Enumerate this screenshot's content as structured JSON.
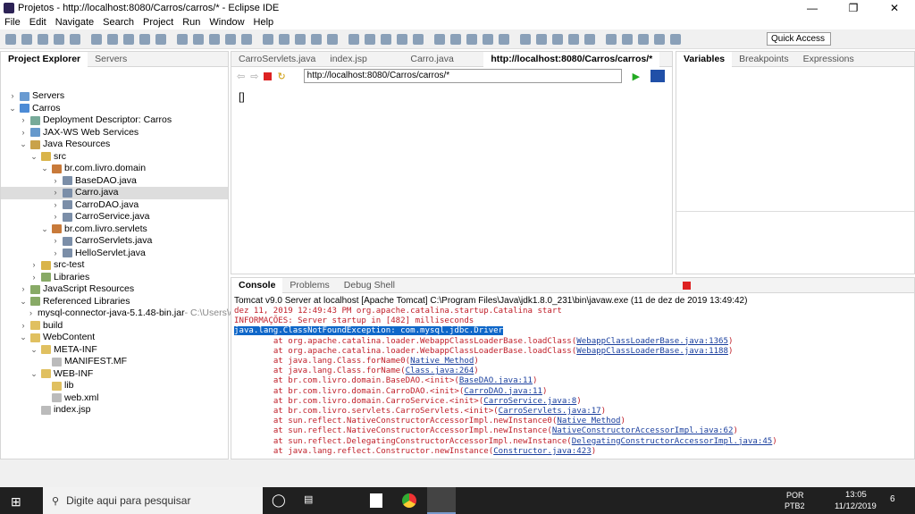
{
  "window": {
    "title": "Projetos - http://localhost:8080/Carros/carros/* - Eclipse IDE"
  },
  "menu": [
    "File",
    "Edit",
    "Navigate",
    "Search",
    "Project",
    "Run",
    "Window",
    "Help"
  ],
  "quick_access": "Quick Access",
  "left_tabs": [
    "Project Explorer",
    "Servers"
  ],
  "tree": [
    {
      "d": 0,
      "tw": ">",
      "label": "Servers",
      "c": "#6a9bd1"
    },
    {
      "d": 0,
      "tw": "v",
      "label": "Carros",
      "c": "#4c8bd6"
    },
    {
      "d": 1,
      "tw": ">",
      "label": "Deployment Descriptor: Carros",
      "c": "#7a9"
    },
    {
      "d": 1,
      "tw": ">",
      "label": "JAX-WS Web Services",
      "c": "#69c"
    },
    {
      "d": 1,
      "tw": "v",
      "label": "Java Resources",
      "c": "#c9a24a"
    },
    {
      "d": 2,
      "tw": "v",
      "label": "src",
      "c": "#d9b44a"
    },
    {
      "d": 3,
      "tw": "v",
      "label": "br.com.livro.domain",
      "c": "#c87a3a"
    },
    {
      "d": 4,
      "tw": ">",
      "label": "BaseDAO.java",
      "c": "#7b8ea8"
    },
    {
      "d": 4,
      "tw": ">",
      "label": "Carro.java",
      "c": "#7b8ea8",
      "sel": true
    },
    {
      "d": 4,
      "tw": ">",
      "label": "CarroDAO.java",
      "c": "#7b8ea8"
    },
    {
      "d": 4,
      "tw": ">",
      "label": "CarroService.java",
      "c": "#7b8ea8"
    },
    {
      "d": 3,
      "tw": "v",
      "label": "br.com.livro.servlets",
      "c": "#c87a3a"
    },
    {
      "d": 4,
      "tw": ">",
      "label": "CarroServlets.java",
      "c": "#7b8ea8"
    },
    {
      "d": 4,
      "tw": ">",
      "label": "HelloServlet.java",
      "c": "#7b8ea8"
    },
    {
      "d": 2,
      "tw": ">",
      "label": "src-test",
      "c": "#d9b44a"
    },
    {
      "d": 2,
      "tw": ">",
      "label": "Libraries",
      "c": "#8a6"
    },
    {
      "d": 1,
      "tw": ">",
      "label": "JavaScript Resources",
      "c": "#8a6"
    },
    {
      "d": 1,
      "tw": "v",
      "label": "Referenced Libraries",
      "c": "#8a6"
    },
    {
      "d": 2,
      "tw": ">",
      "label": "mysql-connector-java-5.1.48-bin.jar",
      "extra": " - C:\\Users\\da",
      "c": "#889"
    },
    {
      "d": 1,
      "tw": ">",
      "label": "build",
      "c": "#e0c060"
    },
    {
      "d": 1,
      "tw": "v",
      "label": "WebContent",
      "c": "#e0c060"
    },
    {
      "d": 2,
      "tw": "v",
      "label": "META-INF",
      "c": "#e0c060"
    },
    {
      "d": 3,
      "tw": "",
      "label": "MANIFEST.MF",
      "c": "#bbb"
    },
    {
      "d": 2,
      "tw": "v",
      "label": "WEB-INF",
      "c": "#e0c060"
    },
    {
      "d": 3,
      "tw": "",
      "label": "lib",
      "c": "#e0c060"
    },
    {
      "d": 3,
      "tw": "",
      "label": "web.xml",
      "c": "#bbb"
    },
    {
      "d": 2,
      "tw": "",
      "label": "index.jsp",
      "c": "#bbb"
    }
  ],
  "editor": {
    "tabs": [
      "CarroServlets.java",
      "index.jsp",
      "Carro.java",
      "http://localhost:8080/Carros/carros/*"
    ],
    "url": "http://localhost:8080/Carros/carros/*",
    "content": "[]"
  },
  "right_tabs": [
    "Variables",
    "Breakpoints",
    "Expressions"
  ],
  "console": {
    "tabs": [
      "Console",
      "Problems",
      "Debug Shell"
    ],
    "header": "Tomcat v9.0 Server at localhost [Apache Tomcat] C:\\Program Files\\Java\\jdk1.8.0_231\\bin\\javaw.exe (11 de dez de 2019 13:49:42)",
    "lines": [
      {
        "t": "dez 11, 2019 12:49:43 PM org.apache.catalina.startup.Catalina start"
      },
      {
        "t": "INFORMAÇÕES: Server startup in [482] milliseconds"
      },
      {
        "t": "java.lang.ClassNotFoundException: com.mysql.jdbc.Driver",
        "hl": true
      },
      {
        "t": "\tat org.apache.catalina.loader.WebappClassLoaderBase.loadClass(",
        "l": "WebappClassLoaderBase.java:1365"
      },
      {
        "t": "\tat org.apache.catalina.loader.WebappClassLoaderBase.loadClass(",
        "l": "WebappClassLoaderBase.java:1188"
      },
      {
        "t": "\tat java.lang.Class.forName0(",
        "l": "Native Method"
      },
      {
        "t": "\tat java.lang.Class.forName(",
        "l": "Class.java:264"
      },
      {
        "t": "\tat br.com.livro.domain.BaseDAO.<init>(",
        "l": "BaseDAO.java:11"
      },
      {
        "t": "\tat br.com.livro.domain.CarroDAO.<init>(",
        "l": "CarroDAO.java:11"
      },
      {
        "t": "\tat br.com.livro.domain.CarroService.<init>(",
        "l": "CarroService.java:8"
      },
      {
        "t": "\tat br.com.livro.servlets.CarroServlets.<init>(",
        "l": "CarroServlets.java:17"
      },
      {
        "t": "\tat sun.reflect.NativeConstructorAccessorImpl.newInstance0(",
        "l": "Native Method"
      },
      {
        "t": "\tat sun.reflect.NativeConstructorAccessorImpl.newInstance(",
        "l": "NativeConstructorAccessorImpl.java:62"
      },
      {
        "t": "\tat sun.reflect.DelegatingConstructorAccessorImpl.newInstance(",
        "l": "DelegatingConstructorAccessorImpl.java:45"
      },
      {
        "t": "\tat java.lang.reflect.Constructor.newInstance(",
        "l": "Constructor.java:423"
      }
    ]
  },
  "taskbar": {
    "search": "Digite aqui para pesquisar",
    "lang1": "POR",
    "lang2": "PTB2",
    "time": "13:05",
    "date": "11/12/2019",
    "notif": "6"
  }
}
